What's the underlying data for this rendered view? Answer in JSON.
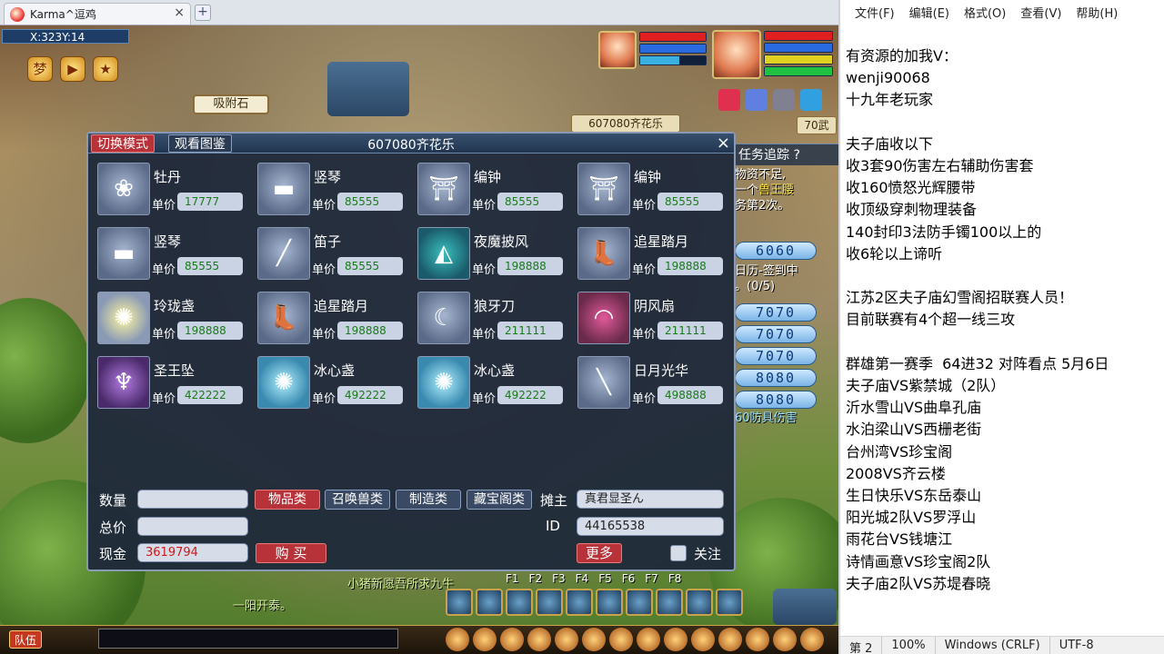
{
  "browser_tab": {
    "title": "Karma^逗鸡",
    "close": "×",
    "new_tab": "+"
  },
  "game": {
    "coord": "X:323Y:14",
    "sign": "吸附石",
    "stall_sign": "607080齐花乐",
    "stall_sign2": "70武",
    "quest_title": "任务追踪 ?",
    "quest_lines": [
      {
        "text": "物资不足,",
        "highlight": ""
      },
      {
        "text": "一个",
        "highlight": "兽王腰"
      },
      {
        "text": "务第2次。",
        "highlight": ""
      },
      {
        "text": "",
        "highlight": ""
      },
      {
        "text": "日历-签到中",
        "highlight": ""
      },
      {
        "text": "。(0/5)",
        "highlight": ""
      }
    ],
    "num_buttons": [
      "6060",
      "7070",
      "7070",
      "7070",
      "8080",
      "8080"
    ],
    "bottom_quest": "60防具伤害",
    "chat_lines": [
      "小猪新愿吾所求九牛",
      "一阳开泰。"
    ],
    "fkeys": [
      "F1",
      "F2",
      "F3",
      "F4",
      "F5",
      "F6",
      "F7",
      "F8"
    ],
    "team_label": "队伍"
  },
  "stall": {
    "mode_switch": "切换模式",
    "view_catalog": "观看图鉴",
    "title": "607080齐花乐",
    "close": "×",
    "price_label": "单价",
    "items": [
      {
        "name": "牡丹",
        "price": "17777",
        "icon": "flower-icon"
      },
      {
        "name": "竖琴",
        "price": "85555",
        "icon": "harp-icon"
      },
      {
        "name": "编钟",
        "price": "85555",
        "icon": "bells-icon"
      },
      {
        "name": "编钟",
        "price": "85555",
        "icon": "bells-icon"
      },
      {
        "name": "竖琴",
        "price": "85555",
        "icon": "harp-icon"
      },
      {
        "name": "笛子",
        "price": "85555",
        "icon": "flute-icon"
      },
      {
        "name": "夜魔披风",
        "price": "198888",
        "icon": "cloak-icon"
      },
      {
        "name": "追星踏月",
        "price": "198888",
        "icon": "boots-icon"
      },
      {
        "name": "玲珑盏",
        "price": "198888",
        "icon": "lamp-icon"
      },
      {
        "name": "追星踏月",
        "price": "198888",
        "icon": "boots-icon"
      },
      {
        "name": "狼牙刀",
        "price": "211111",
        "icon": "blade-icon"
      },
      {
        "name": "阴风扇",
        "price": "211111",
        "icon": "fan-icon"
      },
      {
        "name": "圣王坠",
        "price": "422222",
        "icon": "pendant-icon"
      },
      {
        "name": "冰心盏",
        "price": "492222",
        "icon": "lamp-icon"
      },
      {
        "name": "冰心盏",
        "price": "492222",
        "icon": "lamp-icon"
      },
      {
        "name": "日月光华",
        "price": "498888",
        "icon": "staff-icon"
      }
    ],
    "quantity_label": "数量",
    "total_label": "总价",
    "cash_label": "现金",
    "cash_value": "3619794",
    "buy": "购 买",
    "categories": [
      "物品类",
      "召唤兽类",
      "制造类",
      "藏宝阁类"
    ],
    "owner_label": "摊主",
    "owner_value": "真君显圣ん",
    "id_label": "ID",
    "id_value": "44165538",
    "more": "更多",
    "follow": "关注"
  },
  "notepad": {
    "menu": [
      "文件(F)",
      "编辑(E)",
      "格式(O)",
      "查看(V)",
      "帮助(H)"
    ],
    "lines": [
      "有资源的加我V：",
      "wenji90068",
      "十九年老玩家",
      "",
      "夫子庙收以下",
      "收3套90伤害左右辅助伤害套",
      "收160愤怒光辉腰带",
      "收顶级穿刺物理装备",
      "140封印3法防手镯100以上的",
      "收6轮以上谛听",
      "",
      "江苏2区夫子庙幻雪阁招联赛人员！",
      "目前联赛有4个超一线三攻",
      "",
      "群雄第一赛季  64进32 对阵看点 5月6日",
      "夫子庙VS紫禁城（2队）",
      "沂水雪山VS曲阜孔庙",
      "水泊梁山VS西栅老街",
      "台州湾VS珍宝阁",
      "2008VS齐云楼",
      "生日快乐VS东岳泰山",
      "阳光城2队VS罗浮山",
      "雨花台VS钱塘江",
      "诗情画意VS珍宝阁2队",
      "夫子庙2队VS苏堤春晓"
    ],
    "status": [
      "第 2",
      "100%",
      "Windows (CRLF)",
      "UTF-8"
    ]
  }
}
